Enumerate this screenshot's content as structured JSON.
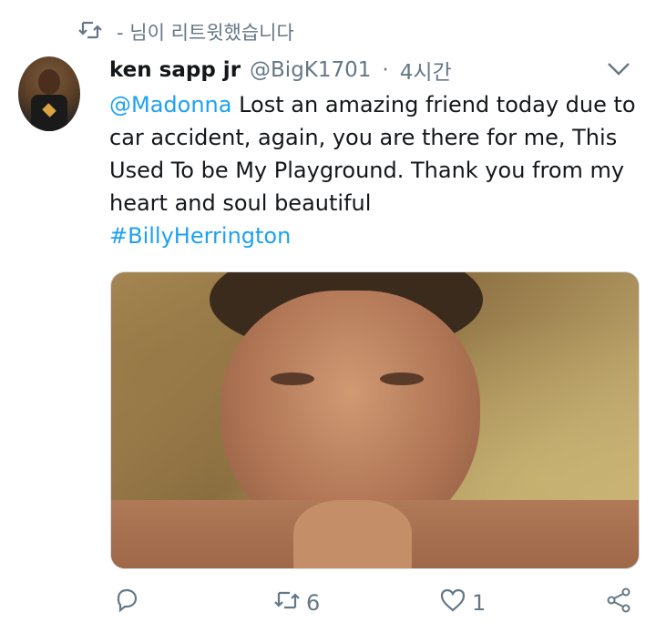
{
  "retweet_context": {
    "text": "- 님이 리트윗했습니다"
  },
  "tweet": {
    "author_name": "ken sapp jr",
    "author_handle": "@BigK1701",
    "separator": "·",
    "time": "4시간",
    "text_mention": "@Madonna",
    "text_body": " Lost an amazing friend today due to car accident, again, you are there for me, This Used To be My Playground. Thank you from my heart and soul beautiful",
    "hashtag": "#BillyHerrington"
  },
  "actions": {
    "retweet_count": "6",
    "like_count": "1"
  },
  "colors": {
    "link": "#1da1f2",
    "muted": "#657786"
  },
  "icons": [
    "retweet-icon",
    "chevron-down-icon",
    "reply-icon",
    "like-icon",
    "share-icon"
  ]
}
